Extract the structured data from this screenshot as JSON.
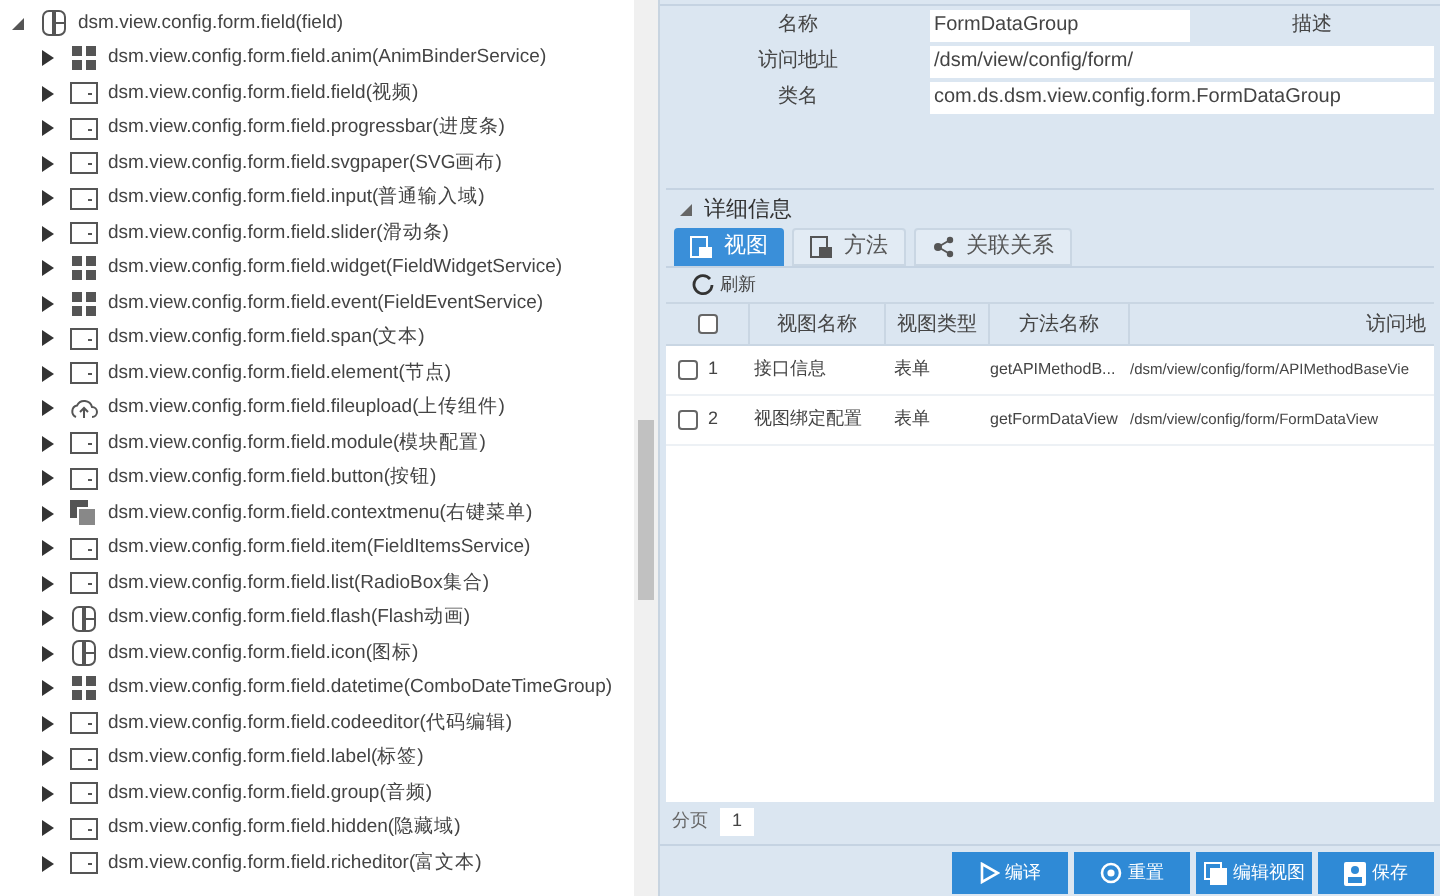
{
  "tree": {
    "label": "dsm.view.config.form.field(field)",
    "expanded": true,
    "kind": "flash",
    "children": [
      {
        "label": "dsm.view.config.form.field.anim(AnimBinderService)",
        "kind": "service",
        "expanded": false
      },
      {
        "label": "dsm.view.config.form.field.field(视频)",
        "kind": "field",
        "expanded": false
      },
      {
        "label": "dsm.view.config.form.field.progressbar(进度条)",
        "kind": "field",
        "expanded": false
      },
      {
        "label": "dsm.view.config.form.field.svgpaper(SVG画布)",
        "kind": "field",
        "expanded": false
      },
      {
        "label": "dsm.view.config.form.field.input(普通输入域)",
        "kind": "field",
        "expanded": false
      },
      {
        "label": "dsm.view.config.form.field.slider(滑动条)",
        "kind": "field",
        "expanded": false
      },
      {
        "label": "dsm.view.config.form.field.widget(FieldWidgetService)",
        "kind": "service",
        "expanded": false
      },
      {
        "label": "dsm.view.config.form.field.event(FieldEventService)",
        "kind": "service",
        "expanded": false
      },
      {
        "label": "dsm.view.config.form.field.span(文本)",
        "kind": "field",
        "expanded": false
      },
      {
        "label": "dsm.view.config.form.field.element(节点)",
        "kind": "field",
        "expanded": false
      },
      {
        "label": "dsm.view.config.form.field.fileupload(上传组件)",
        "kind": "upload",
        "expanded": false
      },
      {
        "label": "dsm.view.config.form.field.module(模块配置)",
        "kind": "field",
        "expanded": false
      },
      {
        "label": "dsm.view.config.form.field.button(按钮)",
        "kind": "field",
        "expanded": false
      },
      {
        "label": "dsm.view.config.form.field.contextmenu(右键菜单)",
        "kind": "menu",
        "expanded": false
      },
      {
        "label": "dsm.view.config.form.field.item(FieldItemsService)",
        "kind": "field",
        "expanded": false
      },
      {
        "label": "dsm.view.config.form.field.list(RadioBox集合)",
        "kind": "field",
        "expanded": false
      },
      {
        "label": "dsm.view.config.form.field.flash(Flash动画)",
        "kind": "flash",
        "expanded": false
      },
      {
        "label": "dsm.view.config.form.field.icon(图标)",
        "kind": "flash",
        "expanded": false
      },
      {
        "label": "dsm.view.config.form.field.datetime(ComboDateTimeGroup)",
        "kind": "service",
        "expanded": false
      },
      {
        "label": "dsm.view.config.form.field.codeeditor(代码编辑)",
        "kind": "field",
        "expanded": false
      },
      {
        "label": "dsm.view.config.form.field.label(标签)",
        "kind": "field",
        "expanded": false
      },
      {
        "label": "dsm.view.config.form.field.group(音频)",
        "kind": "field",
        "expanded": false
      },
      {
        "label": "dsm.view.config.form.field.hidden(隐藏域)",
        "kind": "field",
        "expanded": false
      },
      {
        "label": "dsm.view.config.form.field.richeditor(富文本)",
        "kind": "field",
        "expanded": false
      }
    ]
  },
  "form": {
    "name_label": "名称",
    "name_value": "FormDataGroup",
    "desc_label": "描述",
    "address_label": "访问地址",
    "address_value": "/dsm/view/config/form/",
    "class_label": "类名",
    "class_value": "com.ds.dsm.view.config.form.FormDataGroup"
  },
  "detail": {
    "title": "详细信息",
    "expanded": true,
    "tabs": [
      {
        "label": "视图",
        "selected": true
      },
      {
        "label": "方法",
        "selected": false
      },
      {
        "label": "关联关系",
        "selected": false
      }
    ],
    "refresh": "刷新",
    "table": {
      "all_checked": false,
      "columns": [
        "视图名称",
        "视图类型",
        "方法名称",
        "访问地"
      ],
      "rows": [
        {
          "checked": false,
          "index": "1",
          "cells": [
            "接口信息",
            "表单",
            "getAPIMethodB...",
            "/dsm/view/config/form/APIMethodBaseVie"
          ]
        },
        {
          "checked": false,
          "index": "2",
          "cells": [
            "视图绑定配置",
            "表单",
            "getFormDataView",
            "/dsm/view/config/form/FormDataView"
          ]
        }
      ]
    },
    "pager_label": "分页",
    "page": "1"
  },
  "buttons": [
    {
      "label": "编译",
      "kind": "play"
    },
    {
      "label": "重置",
      "kind": "reset"
    },
    {
      "label": "编辑视图",
      "kind": "edit"
    },
    {
      "label": "保存",
      "kind": "save"
    }
  ]
}
